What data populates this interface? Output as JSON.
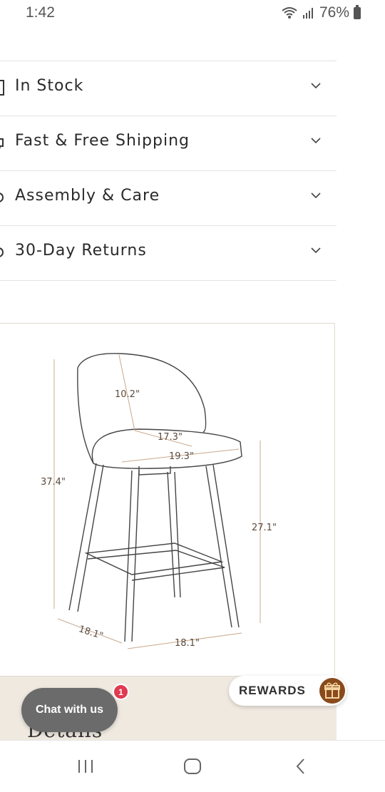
{
  "status_bar": {
    "time": "1:42",
    "battery": "76%"
  },
  "accordion": {
    "items": [
      {
        "label": "In Stock",
        "icon": "box-icon"
      },
      {
        "label": "Fast & Free Shipping",
        "icon": "truck-icon"
      },
      {
        "label": "Assembly & Care",
        "icon": "care-icon"
      },
      {
        "label": "30-Day Returns",
        "icon": "returns-icon"
      }
    ]
  },
  "diagram": {
    "dimensions": {
      "back_height": "10.2\"",
      "seat_depth": "17.3\"",
      "seat_width": "19.3\"",
      "total_height": "37.4\"",
      "seat_height": "27.1\"",
      "base_depth": "18.1\"",
      "base_width": "18.1\""
    }
  },
  "details": {
    "title": "Details"
  },
  "chat": {
    "label": "Chat with us",
    "badge": "1"
  },
  "rewards": {
    "label": "REWARDS",
    "icon": "gift-icon"
  },
  "nav": {
    "recents": "recents-icon",
    "home": "home-icon",
    "back": "back-icon"
  },
  "colors": {
    "accent_brown": "#8a4a1c",
    "badge_red": "#e03a50",
    "details_bg": "#efe9e0",
    "chat_bg": "#6b6b6b"
  }
}
